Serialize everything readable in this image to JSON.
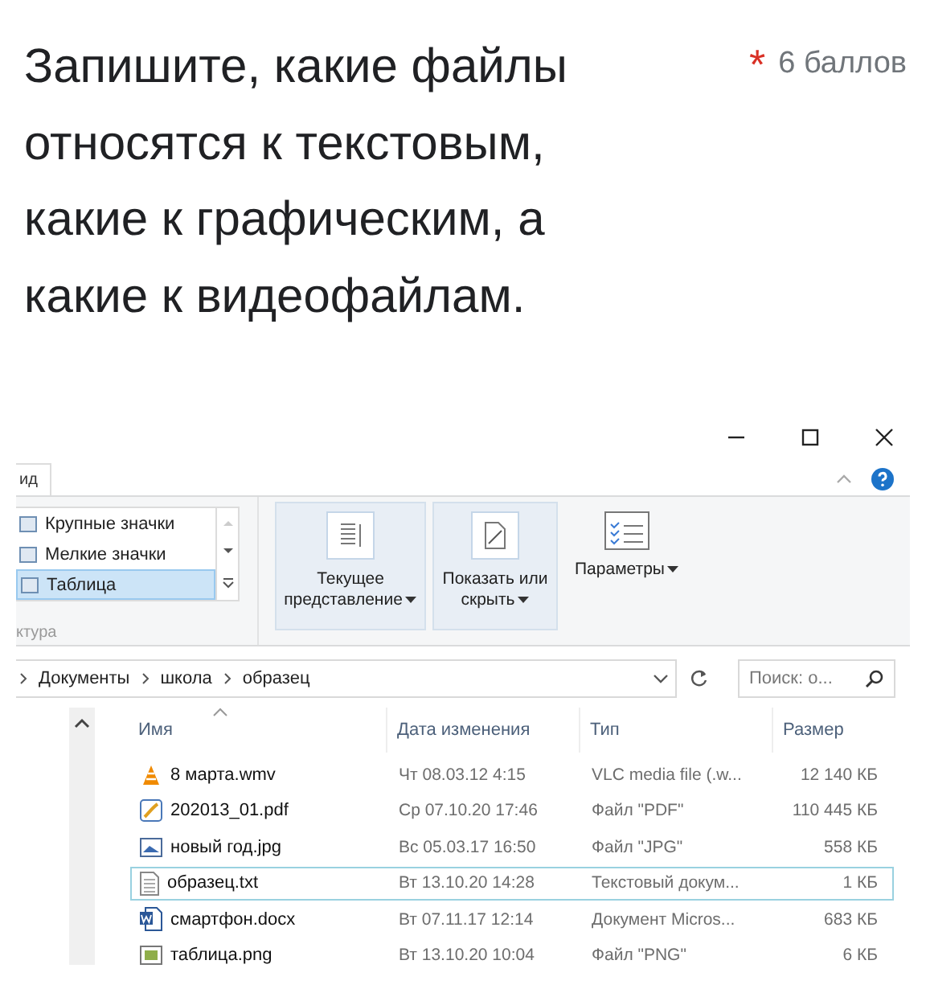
{
  "question": {
    "text": "Запишите, какие файлы относятся к текстовым, какие к графическим, а какие к видеофайлам.",
    "required_mark": "*",
    "points": "6 баллов"
  },
  "explorer": {
    "tab": "ид",
    "layouts": [
      {
        "label": "Крупные значки",
        "selected": false
      },
      {
        "label": "Мелкие значки",
        "selected": false
      },
      {
        "label": "Таблица",
        "selected": true
      }
    ],
    "group_label": "ктура",
    "ribbon_buttons": [
      {
        "label": "Текущее представление",
        "kind": "current-view",
        "selected": true
      },
      {
        "label": "Показать или скрыть",
        "kind": "show-hide",
        "selected": true
      },
      {
        "label": "Параметры",
        "kind": "options",
        "selected": false
      }
    ],
    "breadcrumb": [
      "Документы",
      "школа",
      "образец"
    ],
    "search": {
      "placeholder": "Поиск: о..."
    },
    "columns": [
      "Имя",
      "Дата изменения",
      "Тип",
      "Размер"
    ],
    "files": [
      {
        "name": "8 марта.wmv",
        "kind": "video",
        "date": "Чт 08.03.12 4:15",
        "type": "VLC media file (.w...",
        "size": "12 140 КБ",
        "focused": false
      },
      {
        "name": "202013_01.pdf",
        "kind": "pdf",
        "date": "Ср 07.10.20 17:46",
        "type": "Файл \"PDF\"",
        "size": "110 445 КБ",
        "focused": false
      },
      {
        "name": "новый год.jpg",
        "kind": "image",
        "date": "Вс 05.03.17 16:50",
        "type": "Файл \"JPG\"",
        "size": "558 КБ",
        "focused": false
      },
      {
        "name": "образец.txt",
        "kind": "text",
        "date": "Вт 13.10.20 14:28",
        "type": "Текстовый докум...",
        "size": "1 КБ",
        "focused": true
      },
      {
        "name": "смартфон.docx",
        "kind": "word",
        "date": "Вт 07.11.17 12:14",
        "type": "Документ Micros...",
        "size": "683 КБ",
        "focused": false
      },
      {
        "name": "таблица.png",
        "kind": "png",
        "date": "Вт 13.10.20 10:04",
        "type": "Файл \"PNG\"",
        "size": "6 КБ",
        "focused": false
      }
    ]
  }
}
